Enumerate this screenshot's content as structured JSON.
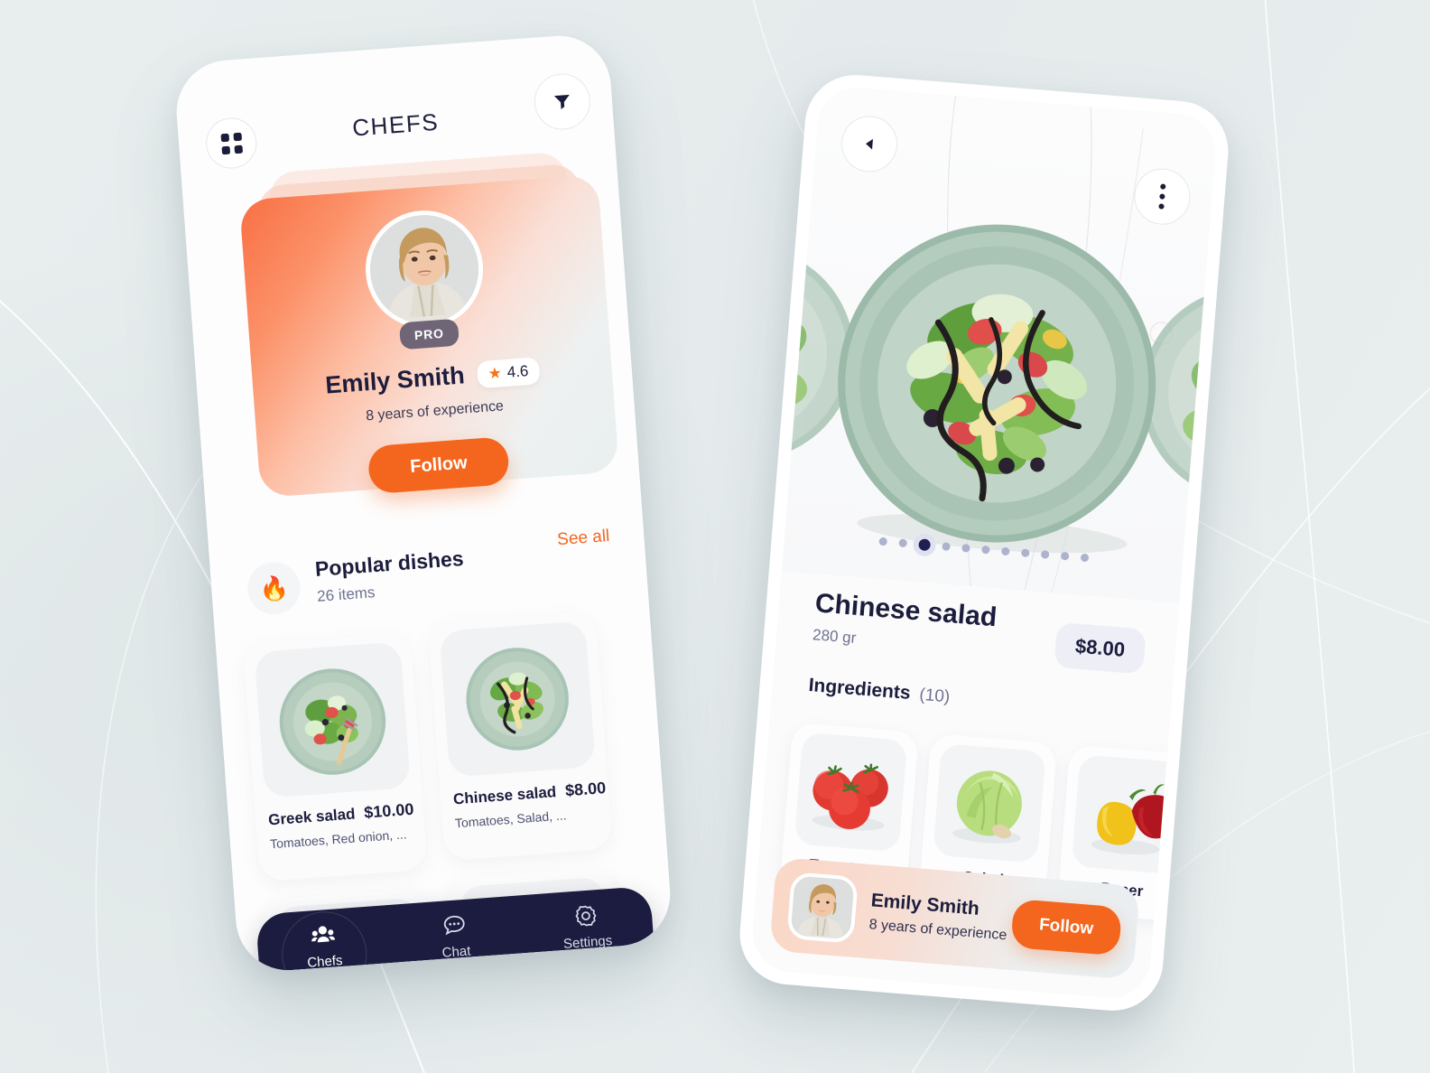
{
  "theme": {
    "accent": "#f4661e",
    "dark": "#1c1d3d",
    "nav_bg": "#1c1c40",
    "muted": "#6e7390",
    "canvas_bg": "#e7eded",
    "price_pill_bg": "#eeeef7",
    "pro_badge_bg": "#6f6577"
  },
  "left_phone": {
    "header": {
      "title": "CHEFS",
      "grid_icon": "grid-icon",
      "filter_icon": "filter-icon"
    },
    "hero": {
      "badge": "PRO",
      "chef_name": "Emily Smith",
      "rating": "4.6",
      "star_icon": "star-icon",
      "experience": "8 years of experience",
      "follow_label": "Follow"
    },
    "popular": {
      "icon": "fire-icon",
      "title": "Popular dishes",
      "subtitle": "26 items",
      "see_all": "See all"
    },
    "dishes": [
      {
        "name": "Greek salad",
        "price": "$10.00",
        "ingredients": "Tomatoes, Red onion, ..."
      },
      {
        "name": "Chinese salad",
        "price": "$8.00",
        "ingredients": "Tomatoes, Salad, ..."
      }
    ],
    "bottom_nav": [
      {
        "label": "Chefs",
        "icon": "people-icon",
        "active": true
      },
      {
        "label": "Chat",
        "icon": "chat-bubble-icon",
        "active": false
      },
      {
        "label": "Settings",
        "icon": "gear-icon",
        "active": false
      }
    ]
  },
  "right_phone": {
    "header": {
      "back_icon": "back-arrow-icon",
      "more_icon": "more-vertical-icon"
    },
    "carousel": {
      "total_dots": 11,
      "active_index": 2
    },
    "detail": {
      "title": "Chinese salad",
      "weight": "280 gr",
      "price": "$8.00",
      "ingredients_label": "Ingredients",
      "ingredients_count": "(10)"
    },
    "ingredients": [
      {
        "name": "Tomatoes",
        "icon": "tomatoes-icon"
      },
      {
        "name": "Salad",
        "icon": "lettuce-icon"
      },
      {
        "name": "Paper",
        "icon": "bell-pepper-icon"
      }
    ],
    "chef_bar": {
      "name": "Emily Smith",
      "experience": "8 years of experience",
      "follow_label": "Follow"
    }
  }
}
